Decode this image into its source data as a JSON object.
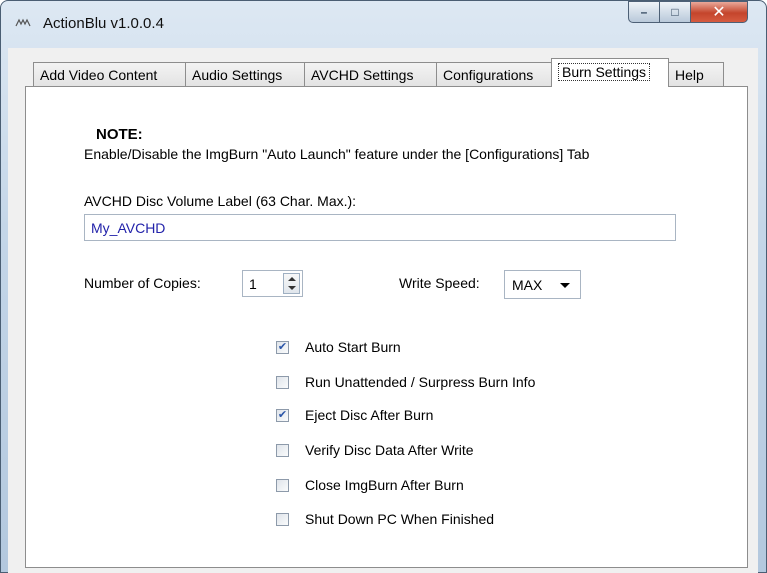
{
  "window": {
    "title": "ActionBlu v1.0.0.4",
    "controls": {
      "minimize": "–",
      "maximize": "□",
      "close": "✕"
    }
  },
  "tabs": [
    {
      "label": "Add Video Content",
      "active": false
    },
    {
      "label": "Audio Settings",
      "active": false
    },
    {
      "label": "AVCHD Settings",
      "active": false
    },
    {
      "label": "Configurations",
      "active": false
    },
    {
      "label": "Burn Settings",
      "active": true
    },
    {
      "label": "Help",
      "active": false
    }
  ],
  "note": {
    "heading": "NOTE:",
    "text": "Enable/Disable the ImgBurn \"Auto Launch\" feature under the [Configurations] Tab"
  },
  "volume_label": {
    "label": "AVCHD Disc Volume Label (63 Char. Max.):",
    "value": "My_AVCHD"
  },
  "copies": {
    "label": "Number of Copies:",
    "value": "1"
  },
  "write_speed": {
    "label": "Write Speed:",
    "value": "MAX"
  },
  "options": [
    {
      "label": "Auto Start Burn",
      "checked": true
    },
    {
      "label": "Run Unattended / Surpress Burn Info",
      "checked": false
    },
    {
      "label": "Eject Disc After Burn",
      "checked": true
    },
    {
      "label": "Verify Disc Data After Write",
      "checked": false
    },
    {
      "label": "Close ImgBurn After Burn",
      "checked": false
    },
    {
      "label": "Shut Down PC When Finished",
      "checked": false
    }
  ],
  "icons": {
    "app": "app-logo-icon",
    "check": "checkmark-icon"
  },
  "colors": {
    "titlebar": "#c4d6e8",
    "close": "#c4452c",
    "input_text": "#2222aa",
    "check": "#2b56a8"
  }
}
